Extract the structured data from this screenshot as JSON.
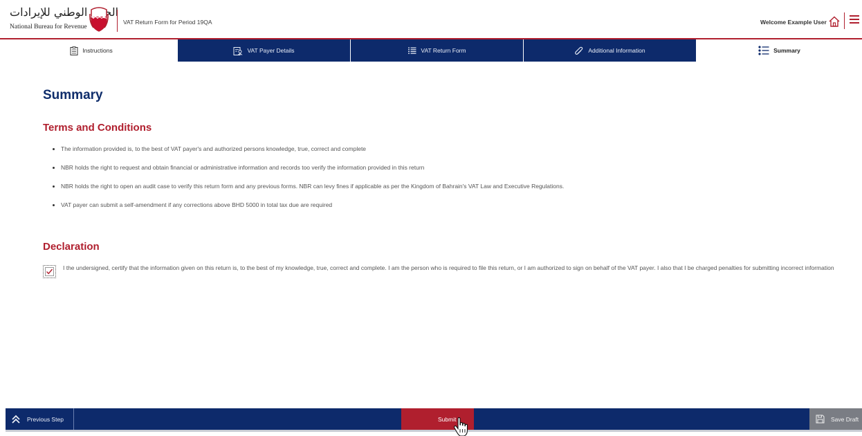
{
  "header": {
    "logo_arabic": "الجهاز الوطني للإيرادات",
    "logo_english": "National Bureau for Revenue",
    "page_title": "VAT Return Form for Period 19QA",
    "welcome": "Welcome Example User"
  },
  "tabs": [
    {
      "label": "Instructions",
      "icon": "document-icon"
    },
    {
      "label": "VAT Payer Details",
      "icon": "user-details-icon"
    },
    {
      "label": "VAT Return Form",
      "icon": "list-icon"
    },
    {
      "label": "Additional Information",
      "icon": "paperclip-icon"
    },
    {
      "label": "Summary",
      "icon": "summary-list-icon",
      "active": true
    }
  ],
  "main": {
    "title": "Summary",
    "terms_heading": "Terms and Conditions",
    "terms": [
      "The information provided is, to the best of VAT payer's and authorized persons knowledge, true, correct and complete",
      "NBR holds the right to request and obtain financial or administrative information and records too verify the information provided in this return",
      "NBR holds the right to open an audit case to verify this return form and any previous forms. NBR can levy fines if applicable as per the Kingdom of Bahrain's VAT Law and Executive Regulations.",
      "VAT payer can submit a self-amendment if any corrections above BHD 5000 in total tax due are required"
    ],
    "declaration_heading": "Declaration",
    "declaration_checked": true,
    "declaration_text": "I the undersigned, certify that the information given on this return is, to the best of my knowledge, true, correct and complete. I am the person who is required to file this return, or I am authorized to sign on behalf of the VAT payer. I also that I be charged penalties for submitting incorrect information"
  },
  "footer": {
    "previous_label": "Previous Step",
    "submit_label": "Submit",
    "save_label": "Save Draft"
  },
  "colors": {
    "navy": "#0d2a6b",
    "red": "#b01f2e",
    "save_gray": "#7a7d84"
  }
}
